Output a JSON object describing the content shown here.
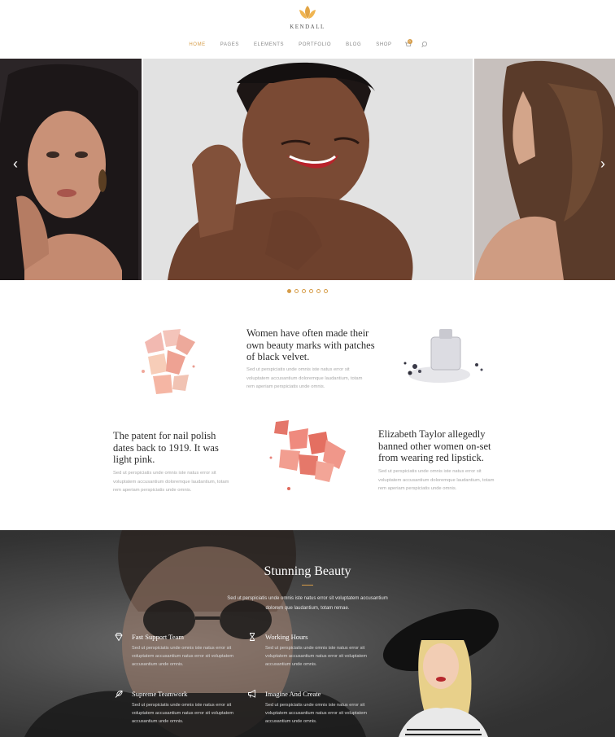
{
  "brand": {
    "name": "KENDALL",
    "logo_icon": "leaf-icon",
    "accent": "#d69c48"
  },
  "nav": {
    "items": [
      {
        "label": "HOME",
        "active": true
      },
      {
        "label": "PAGES",
        "active": false
      },
      {
        "label": "ELEMENTS",
        "active": false
      },
      {
        "label": "PORTFOLIO",
        "active": false
      },
      {
        "label": "BLOG",
        "active": false
      },
      {
        "label": "SHOP",
        "active": false
      }
    ],
    "cart_count": "0",
    "cart_icon": "cart-icon",
    "search_icon": "search-icon"
  },
  "slider": {
    "prev_icon": "chevron-left-icon",
    "next_icon": "chevron-right-icon",
    "prev_glyph": "‹",
    "next_glyph": "›",
    "dots_count": 6,
    "active_dot": 0
  },
  "features": [
    {
      "title": "Women have often made their own beauty marks with patches of black velvet.",
      "text": "Sed ut perspiciatis unde omnis iste natus error sit voluptatem accusantium doloremque laudantium, totam rem aperiam perspiciatis unde omnis."
    },
    {
      "title": "The patent for nail polish dates back to 1919. It was light pink.",
      "text": "Sed ut perspiciatis unde omnis iste natus error sit voluptatem accusantium doloremque laudantium, totam rem aperiam perspiciatis unde omnis."
    },
    {
      "title": "Elizabeth Taylor allegedly banned other women on-set from wearing red lipstick.",
      "text": "Sed ut perspiciatis unde omnis iste natus error sit voluptatem accusantium doloremque laudantium, totam rem aperiam perspiciatis unde omnis."
    }
  ],
  "beauty": {
    "title": "Stunning Beauty",
    "intro": "Sed ut perspiciatis unde omnis iste natus error sit voluptatem accusantium dolorem que laudantium, totam remae.",
    "services": [
      {
        "icon": "diamond-icon",
        "title": "Fast Support Team",
        "text": "Sed ut perspiciatis unde omnis iste natus error sit voluptatem accusantium natus error sit voluptatem accusantium unde omnis."
      },
      {
        "icon": "hourglass-icon",
        "title": "Working Hours",
        "text": "Sed ut perspiciatis unde omnis iste natus error sit voluptatem accusantium natus error sit voluptatem accusantium unde omnis."
      },
      {
        "icon": "feather-icon",
        "title": "Supreme Teamwork",
        "text": "Sed ut perspiciatis unde omnis iste natus error sit voluptatem accusantium natus error sit voluptatem accusantium unde omnis."
      },
      {
        "icon": "megaphone-icon",
        "title": "Imagine And Create",
        "text": "Sed ut perspiciatis unde omnis iste natus error sit voluptatem accusantium natus error sit voluptatem accusantium unde omnis."
      }
    ]
  }
}
